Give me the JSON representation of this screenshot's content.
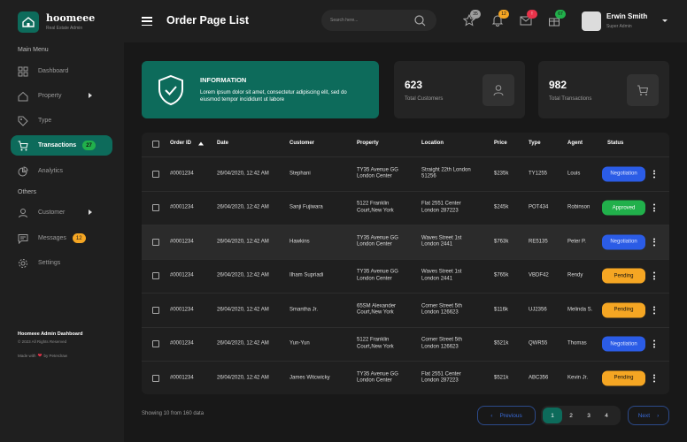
{
  "app": {
    "name": "hoomeee",
    "subtitle": "Real Estate Admin"
  },
  "sidebar": {
    "main_menu": "Main Menu",
    "others": "Others",
    "items": [
      {
        "label": "Dashboard"
      },
      {
        "label": "Property"
      },
      {
        "label": "Type"
      },
      {
        "label": "Transactions",
        "badge": "27"
      },
      {
        "label": "Analytics"
      },
      {
        "label": "Customer"
      },
      {
        "label": "Messages",
        "badge": "12"
      },
      {
        "label": "Settings"
      }
    ],
    "footer": {
      "title": "Hoomeee Admin Dashboard",
      "copyright": "© 2023 All Rights Reserved",
      "made_with": "Made with",
      "by": "by Peterdraw"
    }
  },
  "header": {
    "title": "Order Page List",
    "search_placeholder": "Search here...",
    "notifications": [
      {
        "icon": "star-icon",
        "count": "35",
        "color": "#9e9e9e"
      },
      {
        "icon": "bell-icon",
        "count": "12",
        "color": "#f5a623"
      },
      {
        "icon": "mail-icon",
        "count": "!",
        "color": "#e8334a"
      },
      {
        "icon": "gift-icon",
        "count": "67",
        "color": "#21b04b"
      }
    ],
    "user": {
      "name": "Erwin Smith",
      "role": "Super Admin"
    }
  },
  "info_card": {
    "heading": "INFORMATION",
    "text": "Lorem ipsum dolor sit amet, consectetur adipiscing elit, sed do eiusmod tempor incididunt ut labore"
  },
  "stats": [
    {
      "value": "623",
      "label": "Total Customers",
      "icon": "user-icon"
    },
    {
      "value": "982",
      "label": "Total Transactions",
      "icon": "cart-icon"
    }
  ],
  "table": {
    "columns": [
      "Order ID",
      "Date",
      "Customer",
      "Property",
      "Location",
      "Price",
      "Type",
      "Agent",
      "Status"
    ],
    "rows": [
      {
        "id": "#0001234",
        "date": "26/04/2020, 12:42 AM",
        "customer": "Stephani",
        "property": [
          "TY35 Avenue GG",
          "London Center"
        ],
        "location": [
          "Straight 22th London",
          "51256"
        ],
        "price": "$235k",
        "type": "TY1255",
        "agent": "Louis",
        "status": "Negotiation"
      },
      {
        "id": "#0001234",
        "date": "26/04/2020, 12:42 AM",
        "customer": "Sanji Fujiwara",
        "property": [
          "5122 Franklin",
          "Court,New York"
        ],
        "location": [
          "Flat 2551 Center",
          "London 287223"
        ],
        "price": "$245k",
        "type": "POT434",
        "agent": "Robinson",
        "status": "Approved"
      },
      {
        "id": "#0001234",
        "date": "26/04/2020, 12:42 AM",
        "customer": "Hawkins",
        "property": [
          "TY35 Avenue GG",
          "London Center"
        ],
        "location": [
          "Waves Street 1st",
          "London 2441"
        ],
        "price": "$763k",
        "type": "RE5135",
        "agent": "Peter P.",
        "status": "Negotiation"
      },
      {
        "id": "#0001234",
        "date": "26/04/2020, 12:42 AM",
        "customer": "Ilham Supriadi",
        "property": [
          "TY35 Avenue GG",
          "London Center"
        ],
        "location": [
          "Waves Street 1st",
          "London 2441"
        ],
        "price": "$765k",
        "type": "VBDF42",
        "agent": "Rendy",
        "status": "Pending"
      },
      {
        "id": "#0001234",
        "date": "26/04/2020, 12:42 AM",
        "customer": "Smantha Jr.",
        "property": [
          "65SM Alexander",
          "Court,New York"
        ],
        "location": [
          "Corner Street 5th",
          "London 126623"
        ],
        "price": "$116k",
        "type": "UJ2356",
        "agent": "Melinda S.",
        "status": "Pending"
      },
      {
        "id": "#0001234",
        "date": "26/04/2020, 12:42 AM",
        "customer": "Yun-Yun",
        "property": [
          "5122 Franklin",
          "Court,New York"
        ],
        "location": [
          "Corner Street 5th",
          "London 126623"
        ],
        "price": "$521k",
        "type": "QWR55",
        "agent": "Thomas",
        "status": "Negotiation"
      },
      {
        "id": "#0001234",
        "date": "26/04/2020, 12:42 AM",
        "customer": "James Witcwicky",
        "property": [
          "TY35 Avenue GG",
          "London Center"
        ],
        "location": [
          "Flat 2551 Center",
          "London 287223"
        ],
        "price": "$521k",
        "type": "ABC356",
        "agent": "Kevin Jr.",
        "status": "Pending"
      }
    ],
    "status_colors": {
      "Negotiation": "#2b5ce6",
      "Approved": "#21b04b",
      "Pending": "#f5a623"
    }
  },
  "pagination": {
    "summary": "Showing 10 from 160 data",
    "prev": "Previous",
    "next": "Next",
    "pages": [
      "1",
      "2",
      "3",
      "4"
    ],
    "current": "1"
  },
  "colors": {
    "accent": "#0d6b5b",
    "bg": "#181818",
    "panel": "#1f1f1f"
  }
}
